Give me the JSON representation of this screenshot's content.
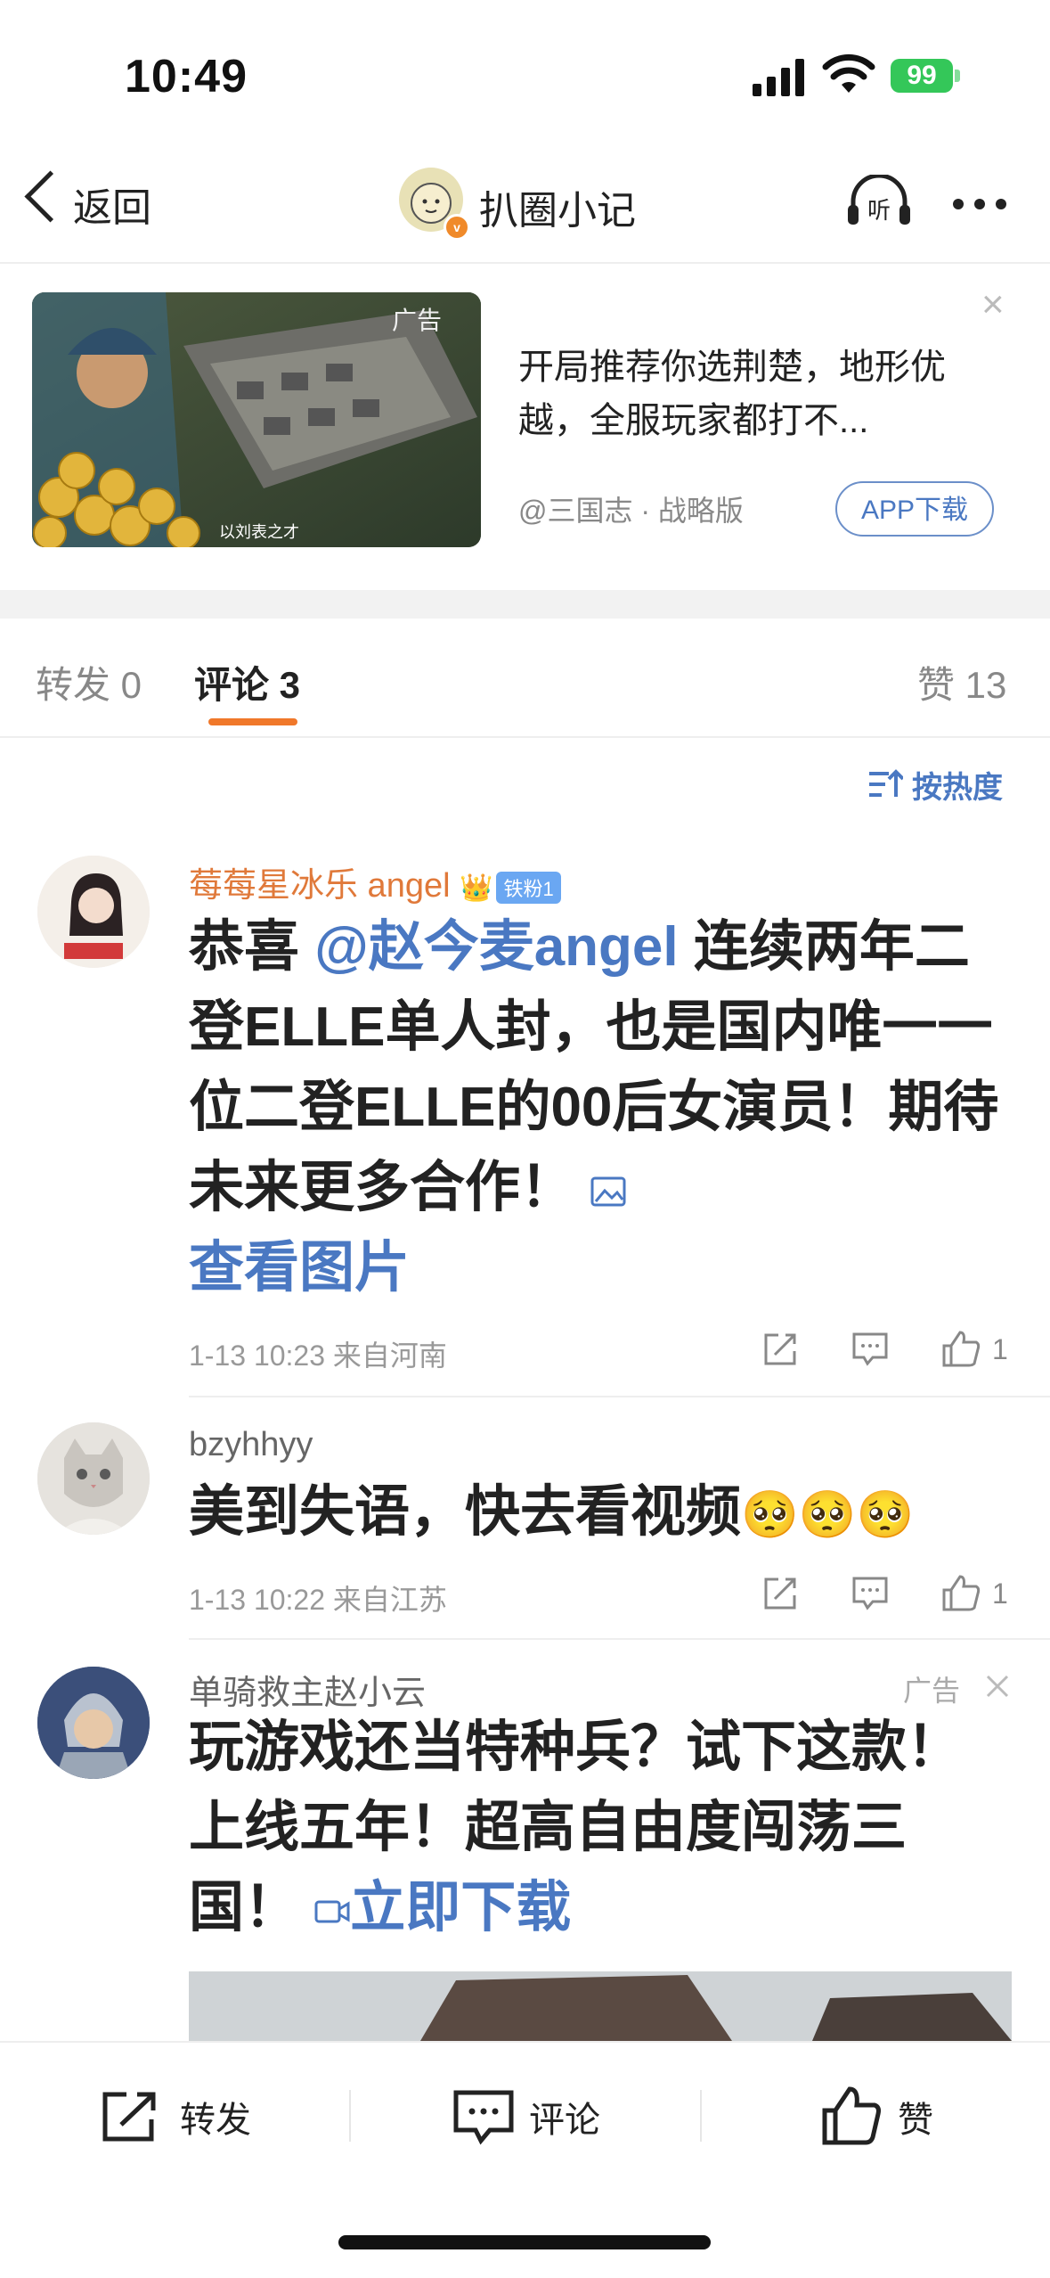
{
  "status_bar": {
    "time": "10:49",
    "battery": "99"
  },
  "nav": {
    "back_label": "返回",
    "title": "扒圈小记",
    "listen_label": "听"
  },
  "ad": {
    "tag": "广告",
    "image_caption": "以刘表之才",
    "text": "开局推荐你选荆楚，地形优越，全服玩家都打不...",
    "source": "@三国志 · 战略版",
    "button": "APP下载",
    "close": "×"
  },
  "tabs": [
    {
      "label": "转发 0"
    },
    {
      "label": "评论 3"
    },
    {
      "label": "赞 13"
    }
  ],
  "sort_label": "按热度",
  "comments": [
    {
      "name": "莓莓星冰乐 angel",
      "badge": "铁粉1",
      "text_prefix": "恭喜 ",
      "mention": "@赵今麦angel",
      "text_body": " 连续两年二登ELLE单人封，也是国内唯一一位二登ELLE的00后女演员！期待未来更多合作！",
      "image_link": "查看图片",
      "meta": "1-13 10:23  来自河南",
      "likes": "1"
    },
    {
      "name": "bzyhhyy",
      "text": "美到失语，快去看视频",
      "emoji": "🥺🥺🥺",
      "meta": "1-13 10:22  来自江苏",
      "likes": "1"
    },
    {
      "name": "单骑救主赵小云",
      "ad_tag": "广告",
      "text": "玩游戏还当特种兵？试下这款！上线五年！超高自由度闯荡三国！",
      "link": "立即下载"
    }
  ],
  "bottom_bar": {
    "repost": "转发",
    "comment": "评论",
    "like": "赞"
  },
  "colors": {
    "accent": "#f0782a",
    "link": "#4a78c2",
    "name_orange": "#e0793a"
  }
}
